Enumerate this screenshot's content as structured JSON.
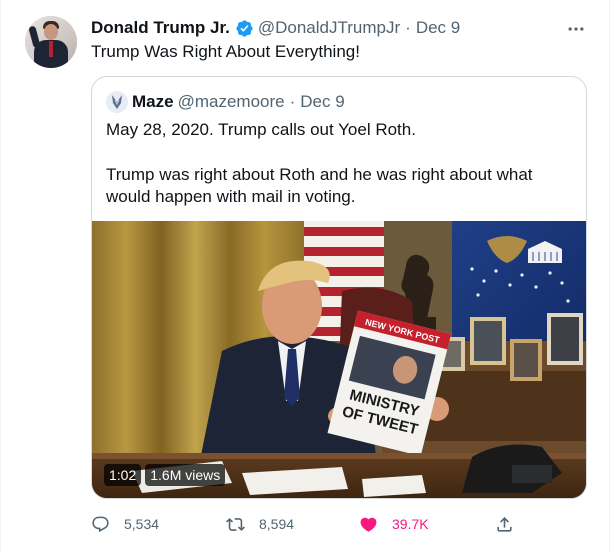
{
  "tweet": {
    "author_name": "Donald Trump Jr.",
    "author_handle": "@DonaldJTrumpJr",
    "separator": "·",
    "date": "Dec 9",
    "text": "Trump Was Right About Everything!",
    "verified_color": "#1d9bf0"
  },
  "quote": {
    "author_name": "Maze",
    "author_handle": "@mazemoore",
    "separator": "·",
    "date": "Dec 9",
    "paragraph_1": "May 28, 2020. Trump calls out Yoel Roth.",
    "paragraph_2": "Trump was right about Roth and he was right about what\nwould happen with mail in voting.",
    "video": {
      "duration": "1:02",
      "views": "1.6M views",
      "newspaper_masthead": "NEW YORK POST",
      "newspaper_headline_1": "MINISTRY",
      "newspaper_headline_2": "OF TWEET",
      "seal_text": "WH"
    }
  },
  "actions": {
    "replies": "5,534",
    "retweets": "8,594",
    "likes": "39.7K",
    "like_color": "#f91880",
    "icon_color": "#536471"
  }
}
